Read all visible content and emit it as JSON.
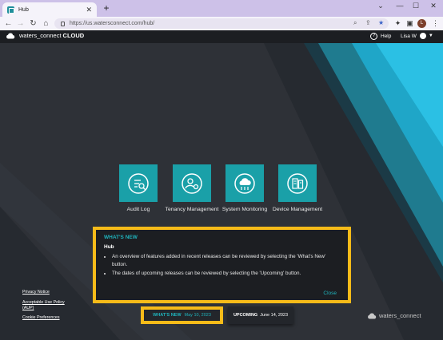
{
  "browser": {
    "tab_title": "Hub",
    "url": "https://us.watersconnect.com/hub/",
    "new_tab": "+",
    "profile_initial": "L"
  },
  "app": {
    "brand_name": "waters_connect",
    "brand_suffix": "CLOUD",
    "help_label": "Help",
    "user_name": "Lisa W"
  },
  "tiles": [
    {
      "label": "Audit Log",
      "icon": "search-list-icon"
    },
    {
      "label": "Tenancy Management",
      "icon": "users-gear-icon"
    },
    {
      "label": "System Monitoring",
      "icon": "cloud-monitor-icon"
    },
    {
      "label": "Device Management",
      "icon": "devices-icon"
    }
  ],
  "whats_new_panel": {
    "heading": "WHAT'S NEW",
    "subheading": "Hub",
    "bullets": [
      "An overview of features added in recent releases can be reviewed by selecting the 'What's New' button.",
      "The dates of upcoming releases can be reviewed by selecting the 'Upcoming' button."
    ],
    "close_label": "Close"
  },
  "footer": {
    "links": [
      "Privacy Notice",
      "Acceptable Use Policy (AUP)",
      "Cookie Preferences"
    ],
    "whats_new_label": "WHAT'S NEW",
    "whats_new_date": "May 10, 2023",
    "upcoming_label": "UPCOMING",
    "upcoming_date": "June 14, 2023",
    "logo_text": "waters_connect"
  },
  "colors": {
    "accent_teal": "#1aa0a8",
    "highlight_yellow": "#f7bb19",
    "header_bg": "#1c1e22"
  }
}
